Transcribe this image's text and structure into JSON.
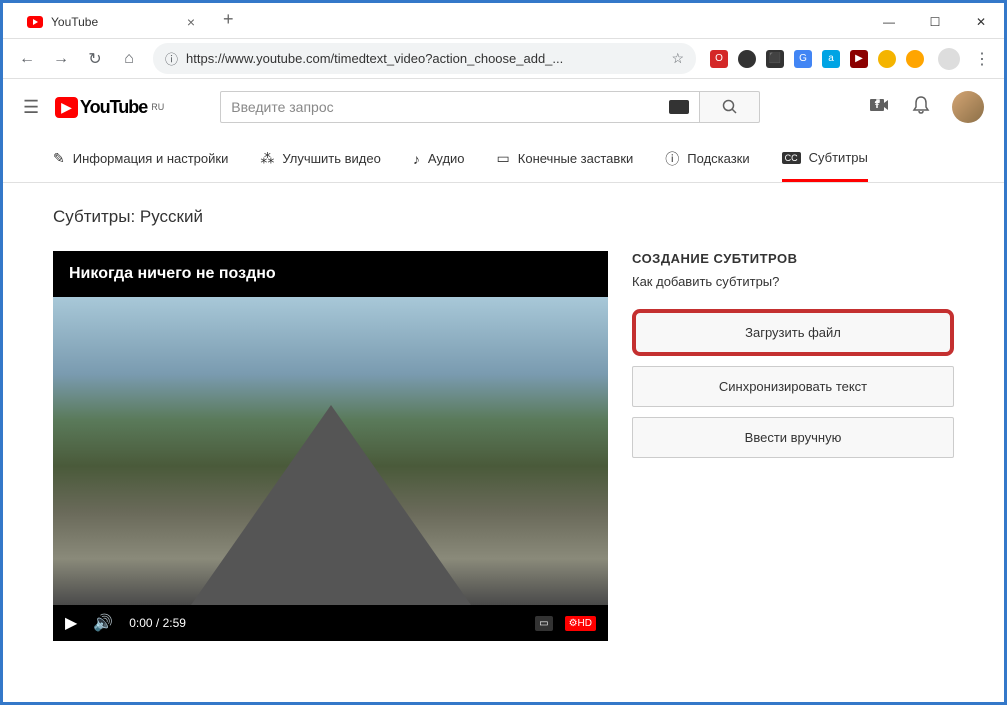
{
  "browser": {
    "tab_title": "YouTube",
    "url_scheme": "https",
    "url_rest": "://www.youtube.com/timedtext_video?action_choose_add_..."
  },
  "yt": {
    "logo_text": "YouTube",
    "logo_region": "RU",
    "search_placeholder": "Введите запрос"
  },
  "tabs": {
    "info": "Информация и настройки",
    "enhance": "Улучшить видео",
    "audio": "Аудио",
    "endscreens": "Конечные заставки",
    "cards": "Подсказки",
    "subtitles": "Субтитры"
  },
  "page": {
    "title": "Субтитры: Русский",
    "video_title": "Никогда ничего не поздно",
    "time_current": "0:00",
    "time_total": "2:59"
  },
  "sidebar": {
    "heading": "СОЗДАНИЕ СУБТИТРОВ",
    "question": "Как добавить субтитры?",
    "upload": "Загрузить файл",
    "sync": "Синхронизировать текст",
    "manual": "Ввести вручную"
  }
}
